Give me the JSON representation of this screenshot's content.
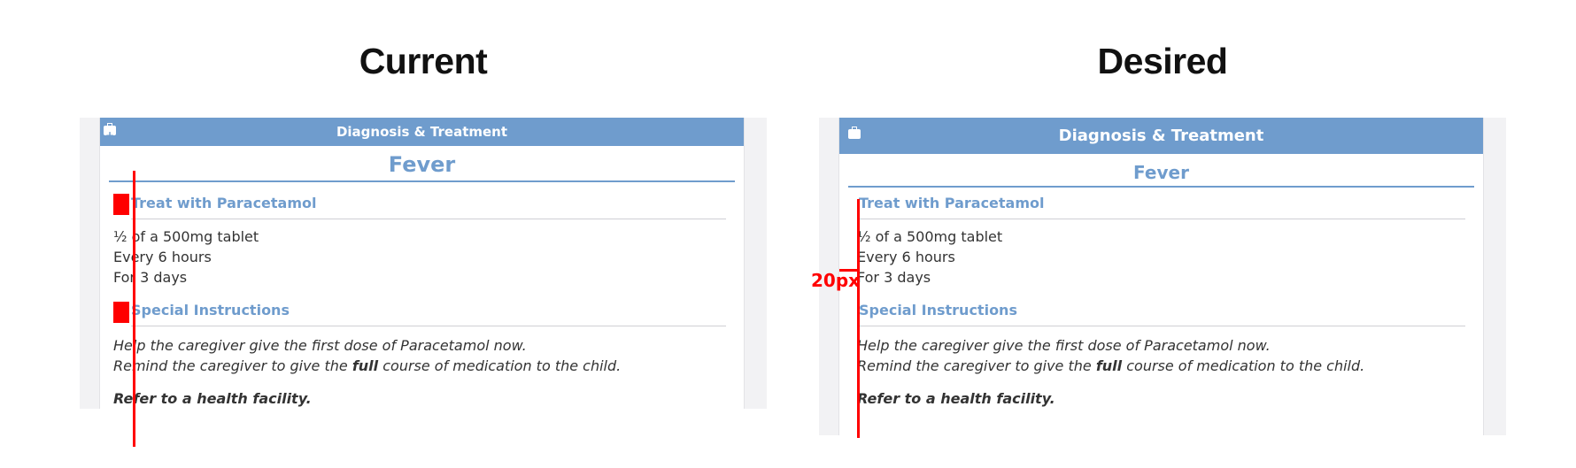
{
  "panels": {
    "current": {
      "heading": "Current",
      "title_bar": "Diagnosis & Treatment",
      "diagnosis": "Fever",
      "section1_title": "Treat with Paracetamol",
      "line1": "½ of a 500mg tablet",
      "line2": "Every 6 hours",
      "line3": "For 3 days",
      "section2_title": "Special Instructions",
      "instr1": "Help the caregiver give the first dose of Paracetamol now.",
      "instr2_pre": "Remind the caregiver to give the ",
      "instr2_bold": "full",
      "instr2_post": " course of medication to the child.",
      "refer": "Refer to a health facility."
    },
    "desired": {
      "heading": "Desired",
      "title_bar": "Diagnosis & Treatment",
      "diagnosis": "Fever",
      "section1_title": "Treat with Paracetamol",
      "line1": "½ of a 500mg tablet",
      "line2": "Every 6 hours",
      "line3": "For 3 days",
      "section2_title": "Special Instructions",
      "instr1": "Help the caregiver give the first dose of Paracetamol now.",
      "instr2_pre": "Remind the caregiver to give the ",
      "instr2_bold": "full",
      "instr2_post": " course of medication to the child.",
      "refer": "Refer to a health facility.",
      "measure_label": "20px"
    }
  },
  "colors": {
    "accent": "#6f9ccd",
    "annotation": "#ff0000",
    "panel_bg": "#f2f2f4"
  },
  "icons": {
    "title_bar_icon": "medical-kit-icon"
  }
}
